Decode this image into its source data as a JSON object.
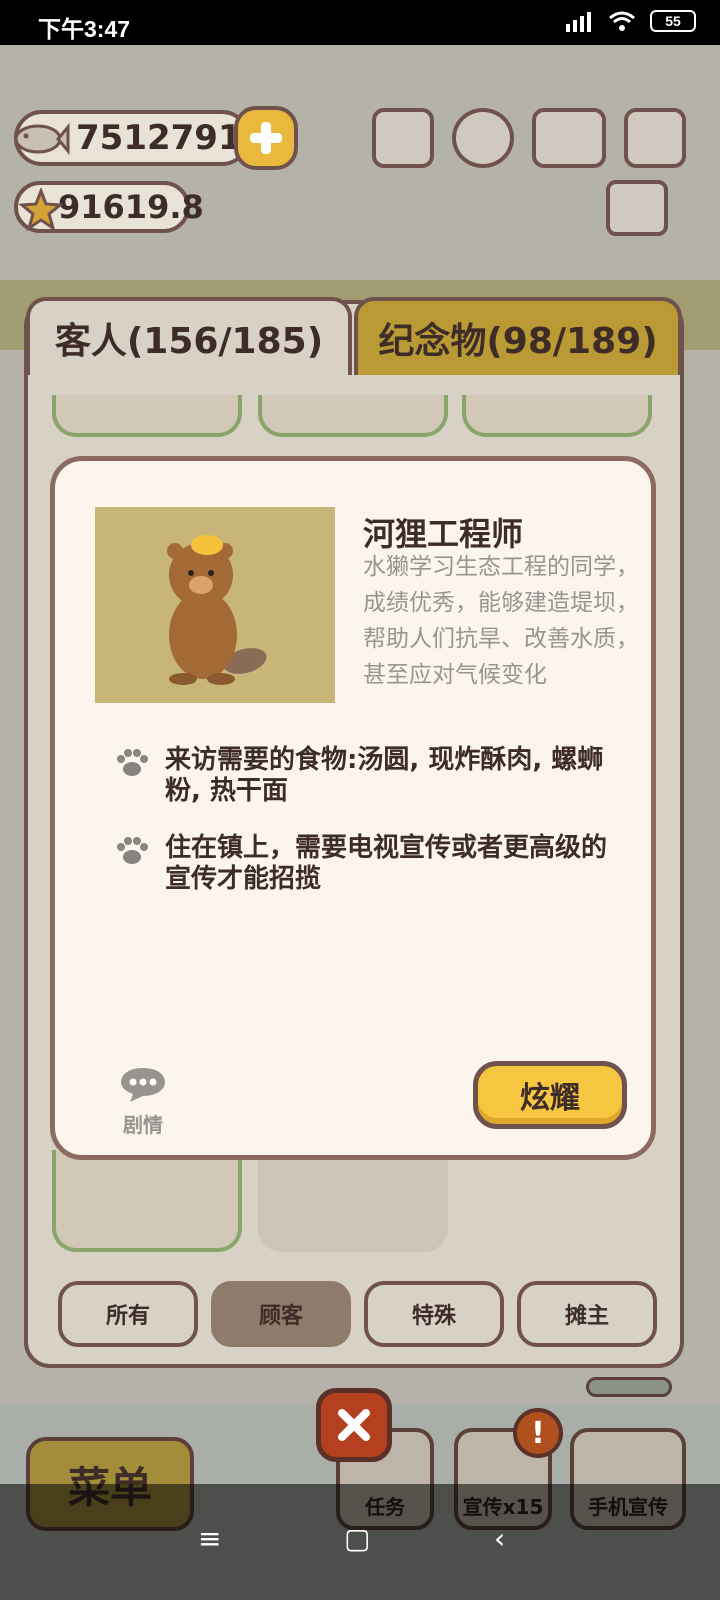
{
  "status_bar": {
    "time": "下午3:47",
    "battery": "55"
  },
  "currency": {
    "fish": "7512791",
    "stars": "91619.8"
  },
  "tabs": {
    "guests": "客人(156/185)",
    "souvenirs": "纪念物(98/189)"
  },
  "dialog": {
    "name": "河狸工程师",
    "description": "水獭学习生态工程的同学，成绩优秀，能够建造堤坝，帮助人们抗旱、改善水质，甚至应对气候变化",
    "requirements": [
      "来访需要的食物:汤圆, 现炸酥肉, 螺蛳粉, 热干面",
      "住在镇上，需要电视宣传或者更高级的宣传才能招揽"
    ],
    "story_label": "剧情",
    "show_button": "炫耀"
  },
  "filters": [
    "所有",
    "顾客",
    "特殊",
    "摊主"
  ],
  "active_filter": "顾客",
  "hud": {
    "menu": "菜单",
    "tasks": "任务",
    "promo": "宣传x15",
    "phone_promo": "手机宣传"
  },
  "colors": {
    "accent_yellow": "#f7c640",
    "panel_border": "#6e524b",
    "souvenir_tab": "#b99a34"
  }
}
